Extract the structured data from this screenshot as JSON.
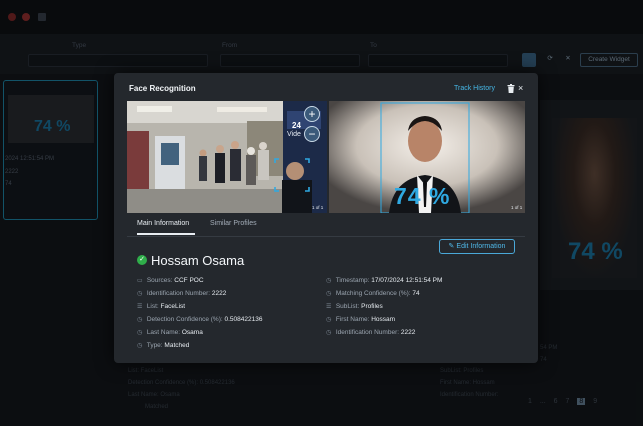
{
  "modal": {
    "title": "Face Recognition",
    "track_history": "Track History",
    "close": "×"
  },
  "media": {
    "left_counter": "1 of 1",
    "right_counter": "1 of 1",
    "confidence_pct": "74 %",
    "booth_text_1": "24",
    "booth_text_2": "Vide",
    "zoom_in": "+",
    "zoom_out": "−"
  },
  "tabs": {
    "main": "Main Information",
    "similar": "Similar Profiles"
  },
  "edit_button": "Edit Information",
  "person": {
    "name": "Hossam Osama",
    "status": "matched"
  },
  "fields_left": [
    {
      "label": "Sources:",
      "value": "CCF POC",
      "icon": "source-icon"
    },
    {
      "label": "Identification Number:",
      "value": "2222",
      "icon": "id-icon"
    },
    {
      "label": "List:",
      "value": "FaceList",
      "icon": "list-icon"
    },
    {
      "label": "Detection Confidence (%):",
      "value": "0.508422136",
      "icon": "confidence-icon"
    },
    {
      "label": "Last Name:",
      "value": "Osama",
      "icon": "name-icon"
    },
    {
      "label": "Type:",
      "value": "Matched",
      "icon": "type-icon"
    }
  ],
  "fields_right": [
    {
      "label": "Timestamp:",
      "value": "17/07/2024 12:51:54 PM",
      "icon": "clock-icon"
    },
    {
      "label": "Matching Confidence (%):",
      "value": "74",
      "icon": "confidence-icon"
    },
    {
      "label": "SubList:",
      "value": "Profiles",
      "icon": "list-icon"
    },
    {
      "label": "First Name:",
      "value": "Hossam",
      "icon": "name-icon"
    },
    {
      "label": "Identification Number:",
      "value": "2222",
      "icon": "id-icon"
    }
  ],
  "background": {
    "type_label": "Type",
    "from_label": "From",
    "to_label": "To",
    "create_widget": "Create Widget",
    "left_pct": "74 %",
    "left_time": "2024 12:51:54 PM",
    "left_id": "2222",
    "left_conf": "74",
    "right_pct": "74 %",
    "right_time": "54 PM",
    "right_conf": "74",
    "bottom_list": "List: FaceList",
    "bottom_detect": "Detection Confidence (%): 0.508422136",
    "bottom_last": "Last Name: Osama",
    "bottom_type": "Matched",
    "bottom_sublist": "SubList: Profiles",
    "bottom_first": "First Name: Hossam",
    "bottom_id": "Identification Number:",
    "pages": [
      "1",
      "...",
      "6",
      "7",
      "8",
      "9"
    ],
    "active_page": "8"
  },
  "colors": {
    "accent": "#46b7e6",
    "match_green": "#2fae4a",
    "modal_bg": "#24282d"
  }
}
